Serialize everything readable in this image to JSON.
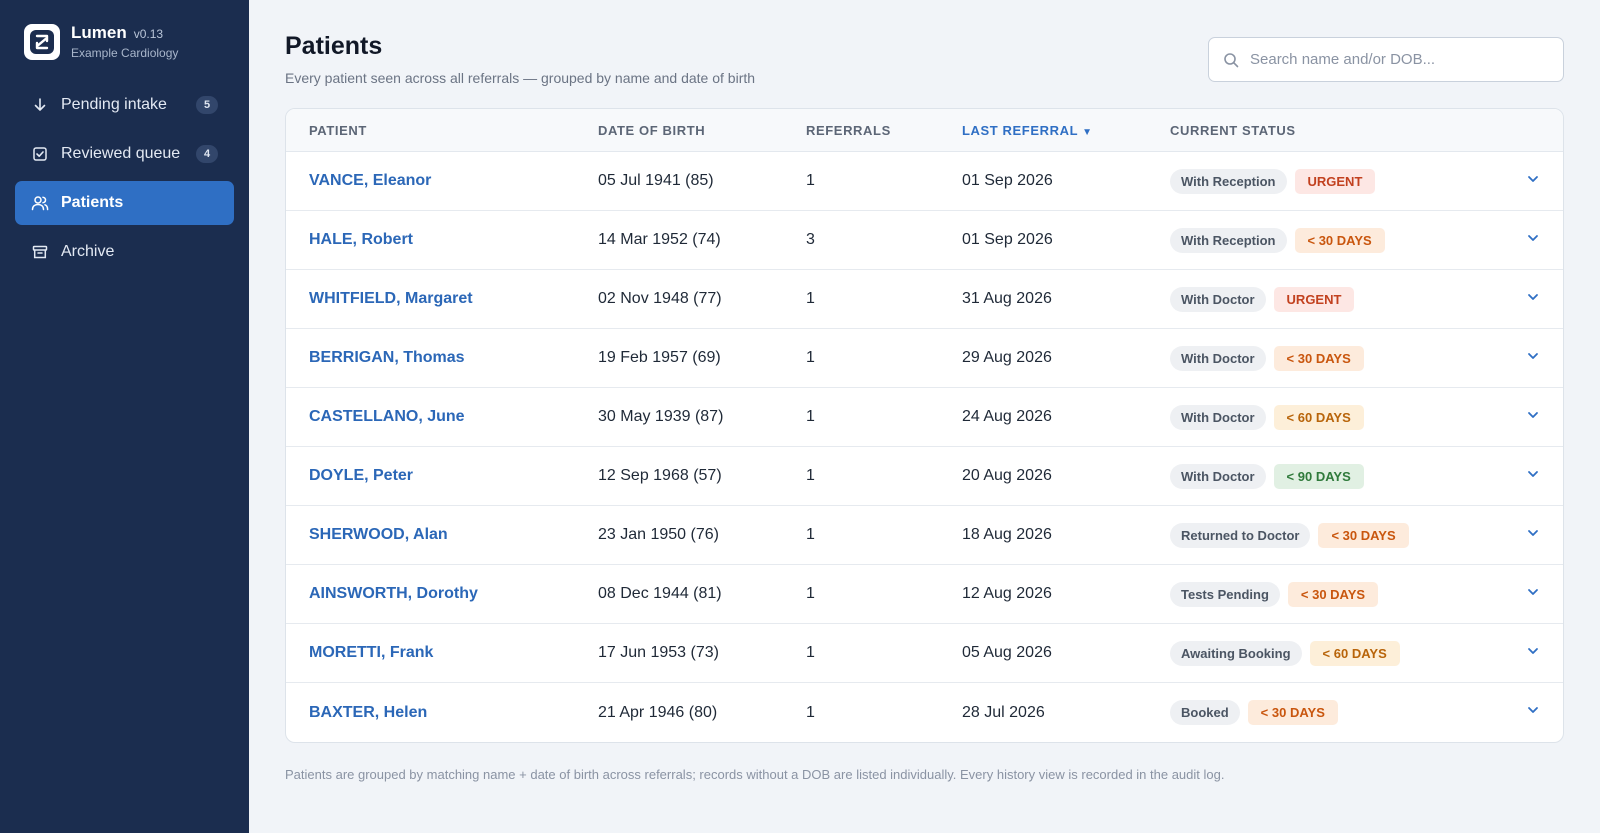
{
  "app": {
    "name": "Lumen",
    "version": "v0.13",
    "org": "Example Cardiology"
  },
  "nav": [
    {
      "label": "Pending intake",
      "count": "5",
      "icon": "arrow-down-icon",
      "active": false
    },
    {
      "label": "Reviewed queue",
      "count": "4",
      "icon": "check-square-icon",
      "active": false
    },
    {
      "label": "Patients",
      "count": "",
      "icon": "users-icon",
      "active": true
    },
    {
      "label": "Archive",
      "count": "",
      "icon": "archive-box-icon",
      "active": false
    }
  ],
  "page": {
    "title": "Patients",
    "subtitle": "Every patient seen across all referrals — grouped by name and date of birth",
    "footnote": "Patients are grouped by matching name + date of birth across referrals; records without a DOB are listed individually. Every history view is recorded in the audit log."
  },
  "search": {
    "placeholder": "Search name and/or DOB...",
    "value": ""
  },
  "table": {
    "headers": {
      "patient": "PATIENT",
      "dob": "DATE OF BIRTH",
      "referrals": "REFERRALS",
      "last_referral": "LAST REFERRAL",
      "sort_indicator": "▼",
      "status": "CURRENT STATUS"
    },
    "rows": [
      {
        "name": "VANCE, Eleanor",
        "dob": "05 Jul 1941 (85)",
        "referrals": "1",
        "last": "01 Sep 2026",
        "status": "With Reception",
        "priority": "URGENT",
        "level": "urgent"
      },
      {
        "name": "HALE, Robert",
        "dob": "14 Mar 1952 (74)",
        "referrals": "3",
        "last": "01 Sep 2026",
        "status": "With Reception",
        "priority": "< 30 DAYS",
        "level": "d30"
      },
      {
        "name": "WHITFIELD, Margaret",
        "dob": "02 Nov 1948 (77)",
        "referrals": "1",
        "last": "31 Aug 2026",
        "status": "With Doctor",
        "priority": "URGENT",
        "level": "urgent"
      },
      {
        "name": "BERRIGAN, Thomas",
        "dob": "19 Feb 1957 (69)",
        "referrals": "1",
        "last": "29 Aug 2026",
        "status": "With Doctor",
        "priority": "< 30 DAYS",
        "level": "d30"
      },
      {
        "name": "CASTELLANO, June",
        "dob": "30 May 1939 (87)",
        "referrals": "1",
        "last": "24 Aug 2026",
        "status": "With Doctor",
        "priority": "< 60 DAYS",
        "level": "d60"
      },
      {
        "name": "DOYLE, Peter",
        "dob": "12 Sep 1968 (57)",
        "referrals": "1",
        "last": "20 Aug 2026",
        "status": "With Doctor",
        "priority": "< 90 DAYS",
        "level": "d90"
      },
      {
        "name": "SHERWOOD, Alan",
        "dob": "23 Jan 1950 (76)",
        "referrals": "1",
        "last": "18 Aug 2026",
        "status": "Returned to Doctor",
        "priority": "< 30 DAYS",
        "level": "d30"
      },
      {
        "name": "AINSWORTH, Dorothy",
        "dob": "08 Dec 1944 (81)",
        "referrals": "1",
        "last": "12 Aug 2026",
        "status": "Tests Pending",
        "priority": "< 30 DAYS",
        "level": "d30"
      },
      {
        "name": "MORETTI, Frank",
        "dob": "17 Jun 1953 (73)",
        "referrals": "1",
        "last": "05 Aug 2026",
        "status": "Awaiting Booking",
        "priority": "< 60 DAYS",
        "level": "d60"
      },
      {
        "name": "BAXTER, Helen",
        "dob": "21 Apr 1946 (80)",
        "referrals": "1",
        "last": "28 Jul 2026",
        "status": "Booked",
        "priority": "< 30 DAYS",
        "level": "d30"
      }
    ]
  },
  "priority_colors": {
    "urgent": {
      "bg": "#fde7e4",
      "fg": "#c2411f"
    },
    "d30": {
      "bg": "#fdebdc",
      "fg": "#c9560e"
    },
    "d60": {
      "bg": "#fdefd9",
      "fg": "#b8640a"
    },
    "d90": {
      "bg": "#e1f0e3",
      "fg": "#2f7a3b"
    }
  },
  "colors": {
    "sidebar_bg": "#1b2d4f",
    "accent": "#2f6fc4",
    "link": "#2b67b7"
  }
}
